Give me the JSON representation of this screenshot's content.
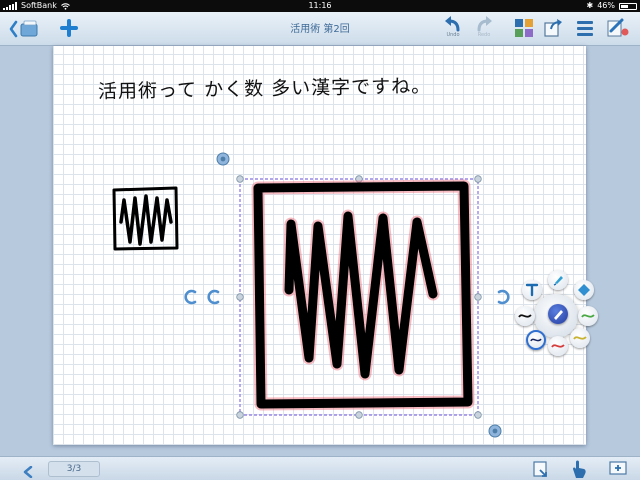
{
  "status_bar": {
    "carrier": "SoftBank",
    "time": "11:16",
    "battery": "46%"
  },
  "toolbar": {
    "title": "活用術 第2回",
    "undo_label": "Undo",
    "redo_label": "Redo"
  },
  "canvas": {
    "note_text": "活用術って かく数 多い漢字ですね。"
  },
  "bottom_bar": {
    "page_indicator": "3/3"
  },
  "colors": {
    "accent": "#1e7fd0",
    "toolbar_text": "#3f6b97",
    "selection": "#8f7fe0",
    "stroke_highlight": "#e25468"
  },
  "icons": [
    "back-arrow-icon",
    "notebook-icon",
    "add-icon",
    "undo-icon",
    "redo-icon",
    "thumbnails-icon",
    "export-icon",
    "menu-icon",
    "handwriting-settings-icon",
    "text-tool-icon",
    "marker-tool-icon",
    "eraser-icon",
    "pen-icon",
    "rotate-icon",
    "page-navigate-icon",
    "insert-page-icon",
    "hand-tool-icon",
    "zoom-window-icon"
  ]
}
